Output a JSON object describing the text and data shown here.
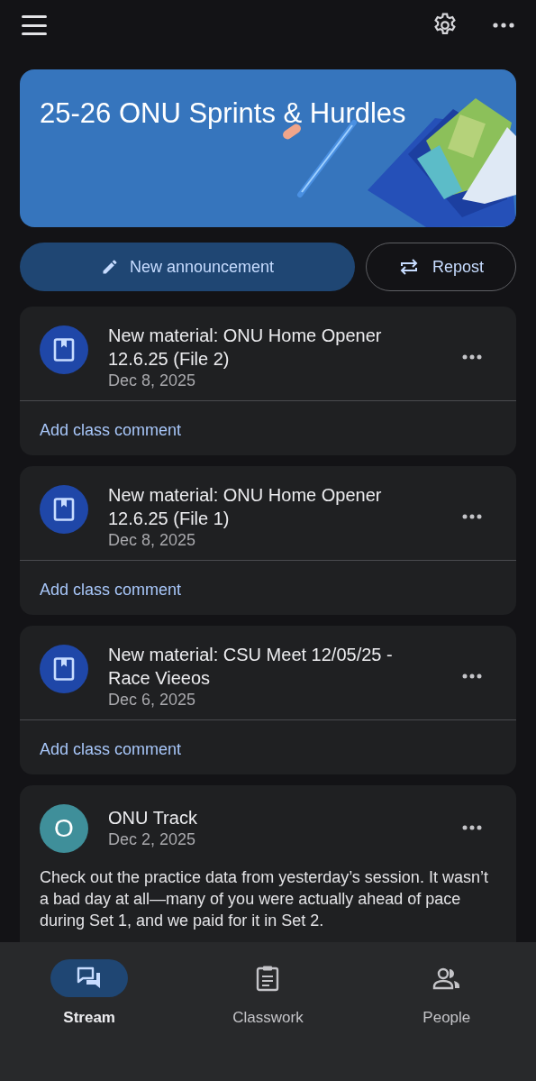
{
  "class_banner": {
    "title": "25-26 ONU Sprints & Hurdles"
  },
  "actions": [
    {
      "kind": "primary",
      "label": "New announcement"
    },
    {
      "kind": "outline",
      "label": "Repost"
    }
  ],
  "posts": [
    {
      "kind": "material",
      "title": "New material: ONU Home Opener 12.6.25 (File 2)",
      "date": "Dec 8, 2025",
      "comment_link": "Add class comment"
    },
    {
      "kind": "material",
      "title": "New material: ONU Home Opener 12.6.25 (File 1)",
      "date": "Dec 8, 2025",
      "comment_link": "Add class comment"
    },
    {
      "kind": "material",
      "title": "New material: CSU Meet 12/05/25 -Race Vieeos",
      "date": "Dec 6, 2025",
      "comment_link": "Add class comment"
    },
    {
      "kind": "announcement",
      "author": "ONU Track",
      "avatar_letter": "O",
      "color": "#3f8f9a",
      "date": "Dec 2, 2025",
      "body": "Check out the practice data from yesterday’s session. It wasn’t a bad day at all—many of you were actually ahead of pace during Set 1, and we paid for it in Set 2."
    }
  ],
  "bottom_nav": [
    {
      "label": "Stream",
      "kind": "stream",
      "selected": true
    },
    {
      "label": "Classwork",
      "kind": "classwork",
      "selected": false
    },
    {
      "label": "People",
      "kind": "people",
      "selected": false
    }
  ]
}
